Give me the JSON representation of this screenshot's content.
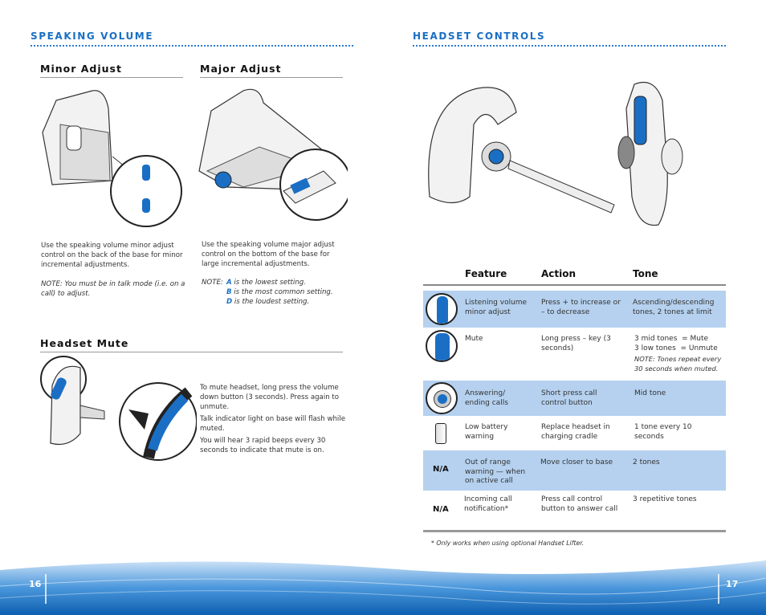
{
  "left": {
    "speaking_volume": {
      "title": "Speaking Volume",
      "minor": {
        "title": "Minor Adjust",
        "text": "Use the speaking volume minor adjust control on the back of the base for minor incremental adjustments.",
        "note": "NOTE: You must be in talk mode (i.e. on a call) to adjust."
      },
      "major": {
        "title": "Major Adjust",
        "text": "Use the speaking volume major adjust control on the bottom of the base for large incremental adjustments.",
        "note_label": "NOTE:",
        "notes": [
          {
            "letter": "A",
            "text": "is the lowest setting."
          },
          {
            "letter": "B",
            "text": "is the most common setting."
          },
          {
            "letter": "D",
            "text": "is the loudest setting."
          }
        ]
      }
    },
    "headset_mute": {
      "title": "Headset Mute",
      "paragraphs": [
        "To mute headset, long press the volume down button (3 seconds). Press again to unmute.",
        "Talk indicator light on base will flash while muted.",
        "You will hear 3 rapid beeps every 30 seconds to indicate that mute is on."
      ]
    },
    "page_number": "16"
  },
  "right": {
    "title": "Headset Controls",
    "table": {
      "headers": [
        "Feature",
        "Action",
        "Tone"
      ],
      "rows": [
        {
          "icon": "volume-buttons-icon",
          "feature": "Listening volume minor adjust",
          "action": "Press + to increase or – to decrease",
          "tone": "Ascending/descending tones, 2 tones at limit"
        },
        {
          "icon": "mute-button-icon",
          "feature": "Mute",
          "action": "Long press – key (3 seconds)",
          "tone": "3 mid tones  = Mute\n3 low tones  = Unmute",
          "tone_note": "NOTE: Tones repeat every 30 seconds when muted."
        },
        {
          "icon": "call-button-icon",
          "feature": "Answering/ ending calls",
          "action": "Short press call control button",
          "tone": "Mid tone"
        },
        {
          "icon": "battery-icon",
          "feature": "Low battery warning",
          "action": "Replace headset in charging cradle",
          "tone": "1 tone every 10 seconds"
        },
        {
          "label": "N/A",
          "feature": "Out of range warning — when on active call",
          "action": "Move closer to base",
          "tone": "2 tones"
        },
        {
          "label": "N/A",
          "feature": "Incoming call notification*",
          "action": "Press call control button to answer call",
          "tone": "3 repetitive tones"
        }
      ],
      "footnote": "* Only works when using optional Handset Lifter."
    },
    "page_number": "17"
  },
  "colors": {
    "accent": "#1a6fc4",
    "row_blue": "#b5d1ef"
  }
}
